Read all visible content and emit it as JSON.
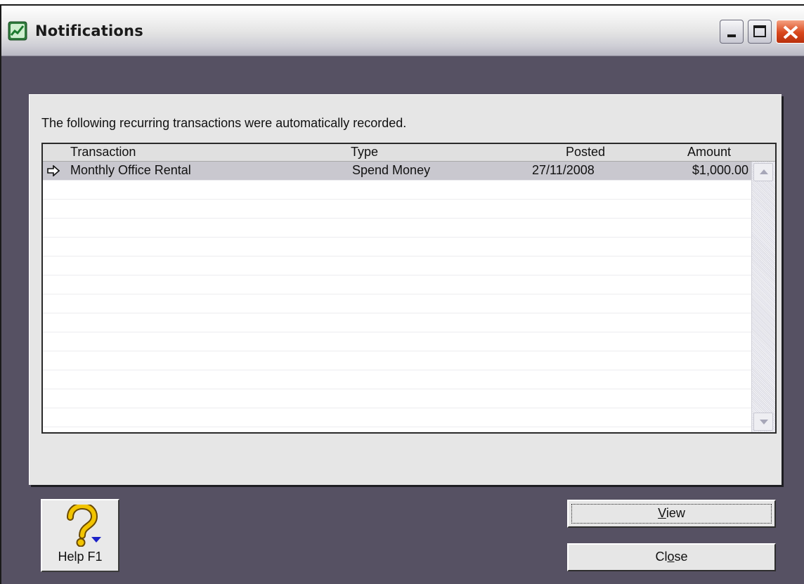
{
  "window": {
    "title": "Notifications",
    "icon": "chart-window-icon",
    "controls": {
      "minimize_icon": "minimize-icon",
      "maximize_icon": "maximize-icon",
      "close_icon": "close-icon",
      "close_color": "#d8471c"
    }
  },
  "panel": {
    "message": "The following recurring transactions were automatically recorded."
  },
  "table": {
    "columns": {
      "transaction": "Transaction",
      "type": "Type",
      "posted": "Posted",
      "amount": "Amount"
    },
    "rows": [
      {
        "selected": true,
        "indicator_icon": "arrow-right-icon",
        "transaction": "Monthly Office Rental",
        "type": "Spend Money",
        "posted": "27/11/2008",
        "amount": "$1,000.00"
      }
    ]
  },
  "buttons": {
    "help": {
      "label": "Help F1",
      "icon": "question-mark-icon"
    },
    "view": {
      "label_mnemonic": "V",
      "label_rest": "iew"
    },
    "close": {
      "label_before": "Cl",
      "label_mnemonic": "o",
      "label_after": "se"
    }
  },
  "colors": {
    "background": "#565163",
    "panel": "#e6e6e6",
    "selected_row": "#c9c8cf",
    "help_icon": "#f2c400"
  }
}
